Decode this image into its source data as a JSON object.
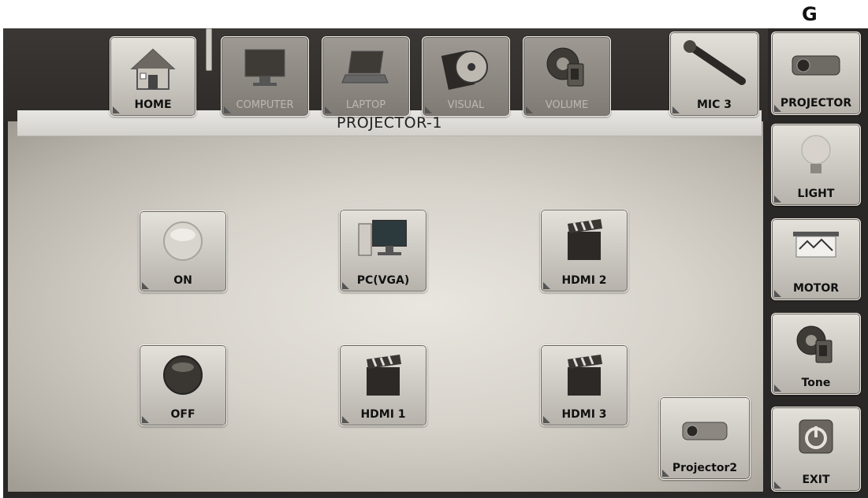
{
  "corner_letter": "G",
  "top_nav": {
    "home": "HOME",
    "computer": "COMPUTER",
    "laptop": "LAPTOP",
    "visual": "VISUAL",
    "volume": "VOLUME",
    "mic": "MIC 3"
  },
  "side_nav": {
    "projector": "PROJECTOR",
    "light": "LIGHT",
    "motor": "MOTOR",
    "tone": "Tone",
    "exit": "EXIT"
  },
  "panel": {
    "title": "PROJECTOR-1",
    "buttons": {
      "on": "ON",
      "pc_vga": "PC(VGA)",
      "hdmi2": "HDMI 2",
      "off": "OFF",
      "hdmi1": "HDMI 1",
      "hdmi3": "HDMI 3",
      "projector2": "Projector2"
    }
  }
}
